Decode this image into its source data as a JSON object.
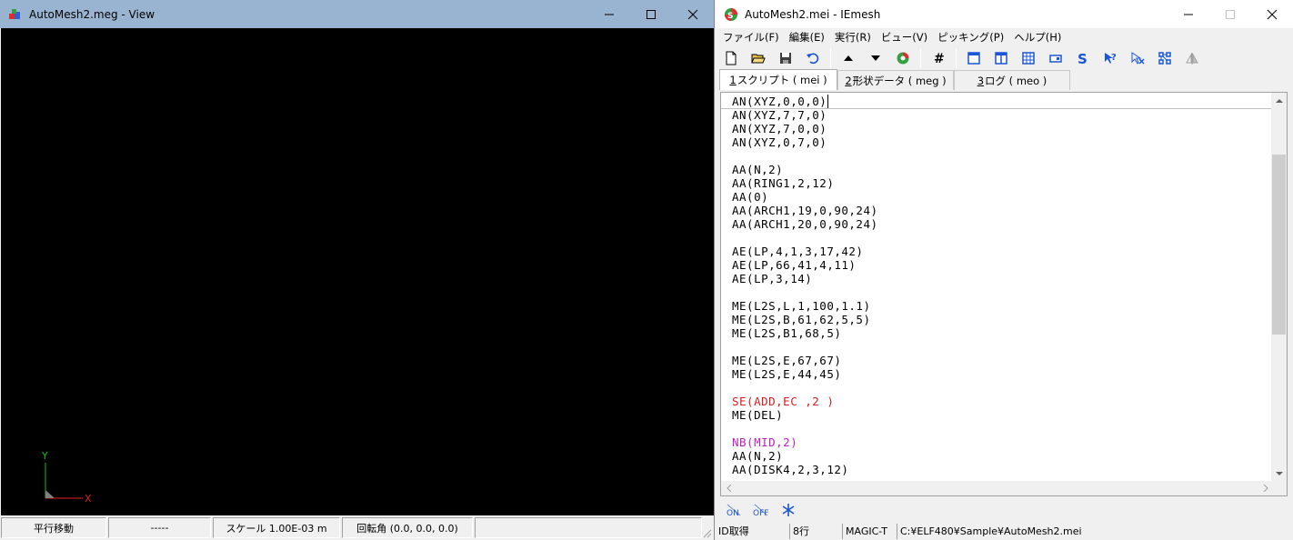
{
  "left_window": {
    "title": "AutoMesh2.meg - View",
    "axis_y": "Y",
    "axis_x": "X",
    "status": [
      "平行移動",
      "-----",
      "スケール 1.00E-03 m",
      "回転角 (0.0, 0.0, 0.0)",
      ""
    ]
  },
  "right_window": {
    "title": "AutoMesh2.mei - IEmesh",
    "menu": [
      "ファイル(F)",
      "編集(E)",
      "実行(R)",
      "ビュー(V)",
      "ピッキング(P)",
      "ヘルプ(H)"
    ],
    "tabs": [
      {
        "num": "1",
        "label": " スクリプト ( mei )"
      },
      {
        "num": "2",
        "label": " 形状データ ( meg )"
      },
      {
        "num": "3",
        "label": " ログ ( meo )"
      }
    ],
    "code_lines": [
      {
        "text": "AN(XYZ,0,0,0)",
        "color": "#000000"
      },
      {
        "text": "AN(XYZ,7,7,0)",
        "color": "#000000"
      },
      {
        "text": "AN(XYZ,7,0,0)",
        "color": "#000000"
      },
      {
        "text": "AN(XYZ,0,7,0)",
        "color": "#000000"
      },
      {
        "text": "",
        "color": "#000000"
      },
      {
        "text": "AA(N,2)",
        "color": "#000000"
      },
      {
        "text": "AA(RING1,2,12)",
        "color": "#000000"
      },
      {
        "text": "AA(0)",
        "color": "#000000"
      },
      {
        "text": "AA(ARCH1,19,0,90,24)",
        "color": "#000000"
      },
      {
        "text": "AA(ARCH1,20,0,90,24)",
        "color": "#000000"
      },
      {
        "text": "",
        "color": "#000000"
      },
      {
        "text": "AE(LP,4,1,3,17,42)",
        "color": "#000000"
      },
      {
        "text": "AE(LP,66,41,4,11)",
        "color": "#000000"
      },
      {
        "text": "AE(LP,3,14)",
        "color": "#000000"
      },
      {
        "text": "",
        "color": "#000000"
      },
      {
        "text": "ME(L2S,L,1,100,1.1)",
        "color": "#000000"
      },
      {
        "text": "ME(L2S,B,61,62,5,5)",
        "color": "#000000"
      },
      {
        "text": "ME(L2S,B1,68,5)",
        "color": "#000000"
      },
      {
        "text": "",
        "color": "#000000"
      },
      {
        "text": "ME(L2S,E,67,67)",
        "color": "#000000"
      },
      {
        "text": "ME(L2S,E,44,45)",
        "color": "#000000"
      },
      {
        "text": "",
        "color": "#000000"
      },
      {
        "text": "SE(ADD,EC ,2 )",
        "color": "#d42020"
      },
      {
        "text": "ME(DEL)",
        "color": "#000000"
      },
      {
        "text": "",
        "color": "#000000"
      },
      {
        "text": "NB(MID,2)",
        "color": "#c020c0"
      },
      {
        "text": "AA(N,2)",
        "color": "#000000"
      },
      {
        "text": "AA(DISK4,2,3,12)",
        "color": "#000000"
      }
    ],
    "status": [
      "ID取得",
      "8行",
      "MAGIC-T",
      "C:¥ELF480¥Sample¥AutoMesh2.mei"
    ]
  },
  "colors": {
    "accent_blue": "#1a56d6",
    "left_titlebar": "#99b4d1"
  }
}
